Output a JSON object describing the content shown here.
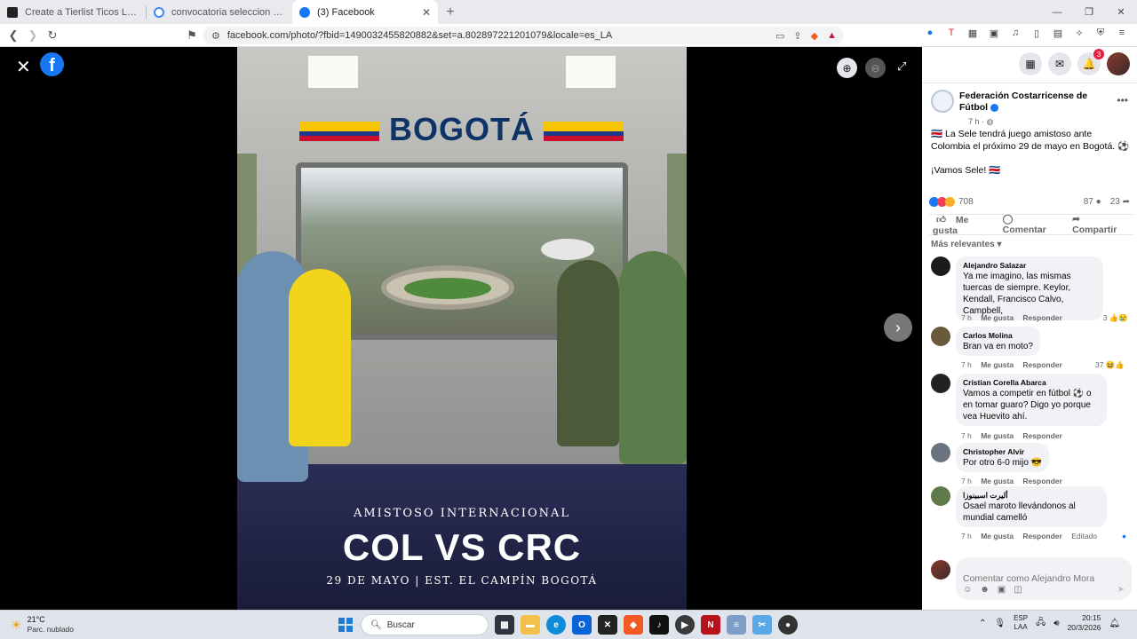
{
  "browser": {
    "tabs": [
      {
        "title": "Create a Tierlist Ticos Legionarios Tie",
        "favicon_color": "#222222",
        "active": false
      },
      {
        "title": "convocatoria seleccion costa rica - B",
        "favicon_color": "#4285f4",
        "active": false
      },
      {
        "title": "(3) Facebook",
        "favicon_color": "#1877f2",
        "active": true
      }
    ],
    "url": "facebook.com/photo/?fbid=1490032455820882&set=a.802897221201079&locale=es_LA"
  },
  "viewer": {
    "photo": {
      "sign": "BOGOTÁ",
      "line1": "AMISTOSO INTERNACIONAL",
      "line2": "COL VS CRC",
      "line3": "29 DE MAYO | EST. EL CAMPÍN BOGOTÁ"
    }
  },
  "post": {
    "page_name": "Federación Costarricense de Fútbol",
    "time": "7 h · ",
    "text1": "🇨🇷 La Sele tendrá juego amistoso ante Colombia el próximo 29 de mayo en Bogotá. ⚽",
    "text2": "¡Vamos Sele! 🇨🇷",
    "reaction_count": "708",
    "comment_count": "87",
    "share_count": "23",
    "actions": {
      "like": "Me gusta",
      "comment": "Comentar",
      "share": "Compartir"
    },
    "sort_label": "Más relevantes"
  },
  "notifications_badge": "3",
  "comments": [
    {
      "author": "Alejandro Salazar",
      "text": "Ya me imagino, las mismas tuercas de siempre. Keylor, Kendall, Francisco Calvo, Campbell,",
      "time": "7 h",
      "like": "Me gusta",
      "reply": "Responder",
      "edited": "",
      "reactions": "3",
      "avatar": "#1b1b1b"
    },
    {
      "author": "Carlos Molina",
      "text": "Bran va en moto?",
      "time": "7 h",
      "like": "Me gusta",
      "reply": "Responder",
      "edited": "",
      "reactions": "37",
      "avatar": "#6a5a3d"
    },
    {
      "author": "Cristian Corella Abarca",
      "text": "Vamos a competir en fútbol ⚽ o en tomar guaro? Digo yo porque vea Huevito ahí.",
      "time": "7 h",
      "like": "Me gusta",
      "reply": "Responder",
      "edited": "",
      "reactions": "",
      "avatar": "#222222"
    },
    {
      "author": "Christopher Alvir",
      "text": "Por otro 6-0 mijo 😎",
      "time": "7 h",
      "like": "Me gusta",
      "reply": "Responder",
      "edited": "",
      "reactions": "",
      "avatar": "#6b7380"
    },
    {
      "author": "أليرت اسبينوزا",
      "text": "Osael maroto llevándonos al mundial camelló",
      "time": "7 h",
      "like": "Me gusta",
      "reply": "Responder",
      "edited": "Editado",
      "reactions": "",
      "avatar": "#5f7a4a"
    }
  ],
  "comment_box": {
    "placeholder": "Comentar como Alejandro Mora"
  },
  "taskbar": {
    "weather_temp": "21°C",
    "weather_desc": "Parc. nublado",
    "search_placeholder": "Buscar",
    "lang1": "ESP",
    "lang2": "LAA",
    "time": "20:15",
    "date": "20/3/2026"
  }
}
